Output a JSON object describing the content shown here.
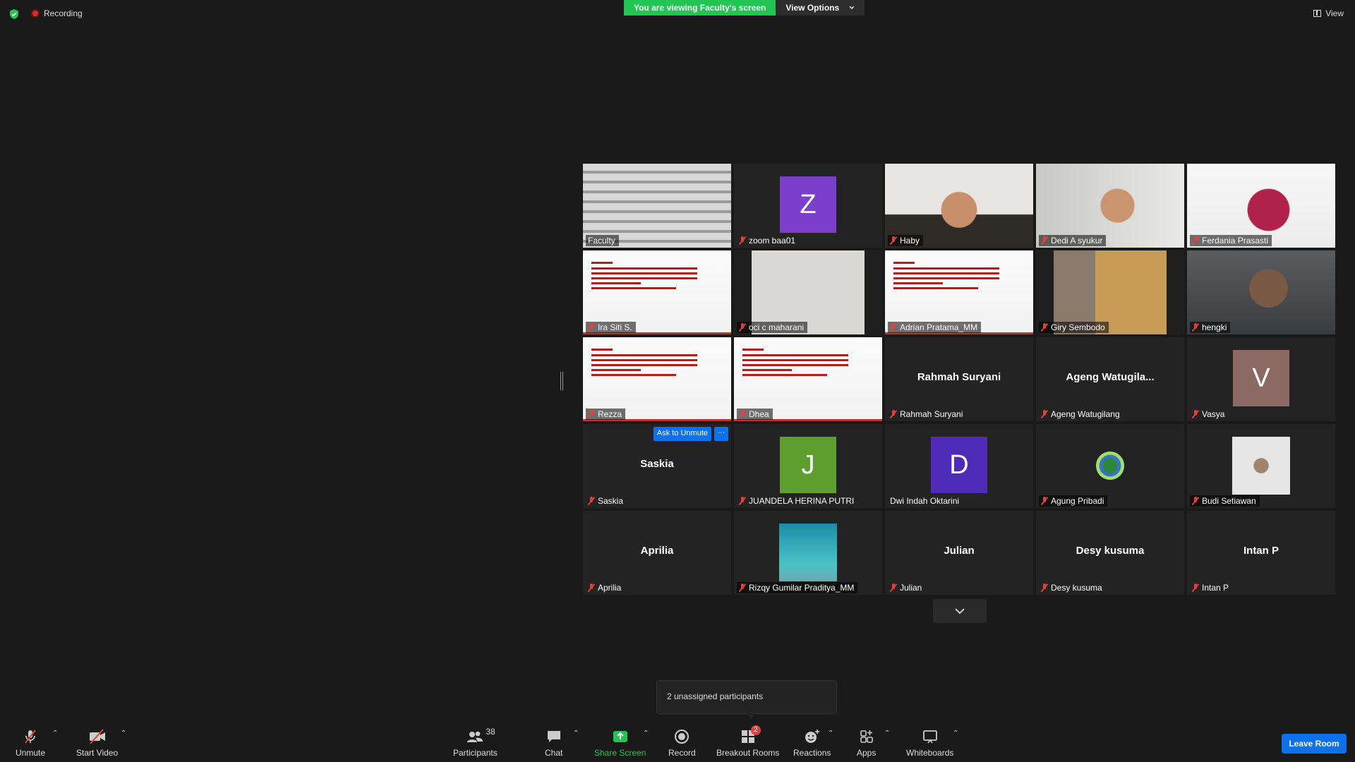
{
  "topbar": {
    "recording_label": "Recording",
    "banner_text": "You are viewing Faculty's screen",
    "view_options_label": "View Options",
    "view_label": "View"
  },
  "tiles": [
    {
      "name": "Faculty",
      "type": "video",
      "active": true
    },
    {
      "name": "zoom baa01",
      "type": "avatar",
      "letter": "Z",
      "color": "#7b3fcb"
    },
    {
      "name": "Haby",
      "type": "video"
    },
    {
      "name": "Dedi A syukur",
      "type": "video"
    },
    {
      "name": "Ferdania Prasasti",
      "type": "video"
    },
    {
      "name": "Ira Siti S.",
      "type": "slide"
    },
    {
      "name": "oci c maharani",
      "type": "video"
    },
    {
      "name": "Adrian Pratama_MM",
      "type": "slide"
    },
    {
      "name": "Giry Sembodo",
      "type": "video"
    },
    {
      "name": "hengki",
      "type": "video"
    },
    {
      "name": "Rezza",
      "type": "slide"
    },
    {
      "name": "Dhea",
      "type": "slide"
    },
    {
      "name": "Rahmah Suryani",
      "type": "name",
      "big": "Rahmah Suryani"
    },
    {
      "name": "Ageng Watugilang",
      "type": "name",
      "big": "Ageng  Watugila..."
    },
    {
      "name": "Vasya",
      "type": "avatar",
      "letter": "V",
      "color": "#8c6a63"
    },
    {
      "name": "Saskia",
      "type": "name",
      "big": "Saskia",
      "ask": "Ask to Unmute",
      "more": "···"
    },
    {
      "name": "JUANDELA HERINA PUTRI",
      "type": "avatar",
      "letter": "J",
      "color": "#5e9e2f"
    },
    {
      "name": "Dwi Indah Oktarini",
      "type": "avatar",
      "letter": "D",
      "color": "#4e2ab8",
      "unmuted": true
    },
    {
      "name": "Agung Pribadi",
      "type": "video"
    },
    {
      "name": "Budi Setiawan",
      "type": "video"
    },
    {
      "name": "Aprilia",
      "type": "name",
      "big": "Aprilia"
    },
    {
      "name": "Rizqy Gumilar Praditya_MM",
      "type": "video"
    },
    {
      "name": "Julian",
      "type": "name",
      "big": "Julian"
    },
    {
      "name": "Desy kusuma",
      "type": "name",
      "big": "Desy kusuma"
    },
    {
      "name": "Intan P",
      "type": "name",
      "big": "Intan P"
    }
  ],
  "tooltip": {
    "text": "2 unassigned participants"
  },
  "toolbar": {
    "unmute": "Unmute",
    "start_video": "Start Video",
    "participants": "Participants",
    "participants_count": "38",
    "chat": "Chat",
    "share_screen": "Share Screen",
    "record": "Record",
    "breakout_rooms": "Breakout Rooms",
    "breakout_badge": "2",
    "reactions": "Reactions",
    "apps": "Apps",
    "whiteboards": "Whiteboards",
    "leave_room": "Leave Room"
  }
}
